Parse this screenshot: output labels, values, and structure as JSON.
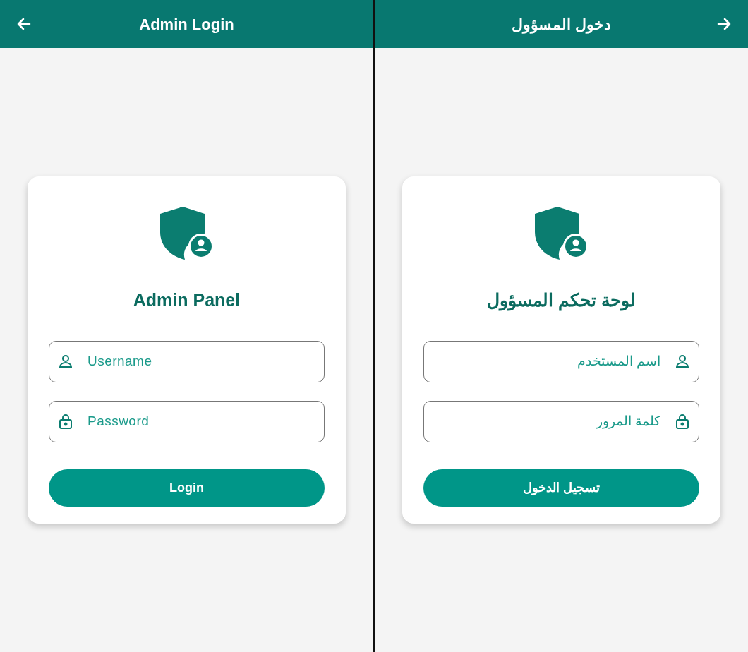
{
  "left_panel": {
    "kind": "ltr",
    "header": {
      "title": "Admin Login"
    },
    "card": {
      "title": "Admin Panel",
      "fields": [
        {
          "kind": "username",
          "placeholder": "Username"
        },
        {
          "kind": "password",
          "placeholder": "Password"
        }
      ],
      "button": "Login"
    }
  },
  "right_panel": {
    "kind": "rtl",
    "header": {
      "title": "دخول المسؤول"
    },
    "card": {
      "title": "لوحة تحكم المسؤول",
      "fields": [
        {
          "kind": "username",
          "placeholder": "اسم المستخدم"
        },
        {
          "kind": "password",
          "placeholder": "كلمة المرور"
        }
      ],
      "button": "تسجيل الدخول"
    }
  }
}
